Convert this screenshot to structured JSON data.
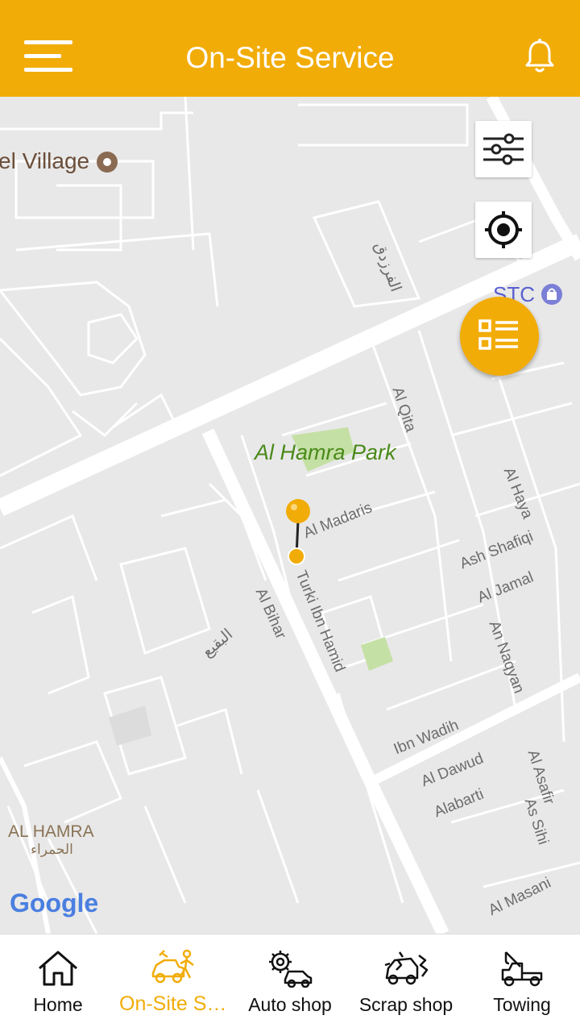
{
  "header": {
    "title": "On-Site Service",
    "menu_icon": "hamburger-menu-icon",
    "notification_icon": "bell-icon",
    "background_color": "#f2ac08"
  },
  "map": {
    "labels": {
      "hotel_village": "el Village",
      "stc": "STC",
      "park": "Al Hamra Park",
      "al_qita": "Al Qita",
      "al_haya": "Al Haya",
      "al_madaris": "Al Madaris",
      "turki_ibn_hamid": "Turki Ibn Hamid",
      "al_bihar": "Al Bihar",
      "ash_shafiqi": "Ash Shafiqi",
      "al_jamal": "Al Jamal",
      "an_naqyan": "An Naqyan",
      "ibn_wadih": "Ibn Wadih",
      "al_dawud": "Al Dawud",
      "alabarti": "Alabarti",
      "al_asafir": "Al Asafir",
      "as_sihi": "As Sihi",
      "al_masani": "Al Masani",
      "al_hamra_en": "AL HAMRA",
      "al_hamra_ar": "الحمراء",
      "arabic_street_1": "الفرزدق",
      "arabic_street_2": "البقيع",
      "google": "Google"
    },
    "controls": {
      "filter_icon": "sliders-filter-icon",
      "locate_icon": "crosshair-locate-icon",
      "list_icon": "list-view-icon"
    },
    "marker_color": "#f2ac08"
  },
  "bottom_nav": {
    "items": [
      {
        "label": "Home",
        "icon": "home-icon",
        "active": false
      },
      {
        "label": "On-Site Service",
        "icon": "on-site-service-icon",
        "active": true
      },
      {
        "label": "Auto shop",
        "icon": "auto-shop-icon",
        "active": false
      },
      {
        "label": "Scrap shop",
        "icon": "scrap-shop-icon",
        "active": false
      },
      {
        "label": "Towing",
        "icon": "tow-truck-icon",
        "active": false
      }
    ],
    "active_color": "#f2ac08"
  }
}
